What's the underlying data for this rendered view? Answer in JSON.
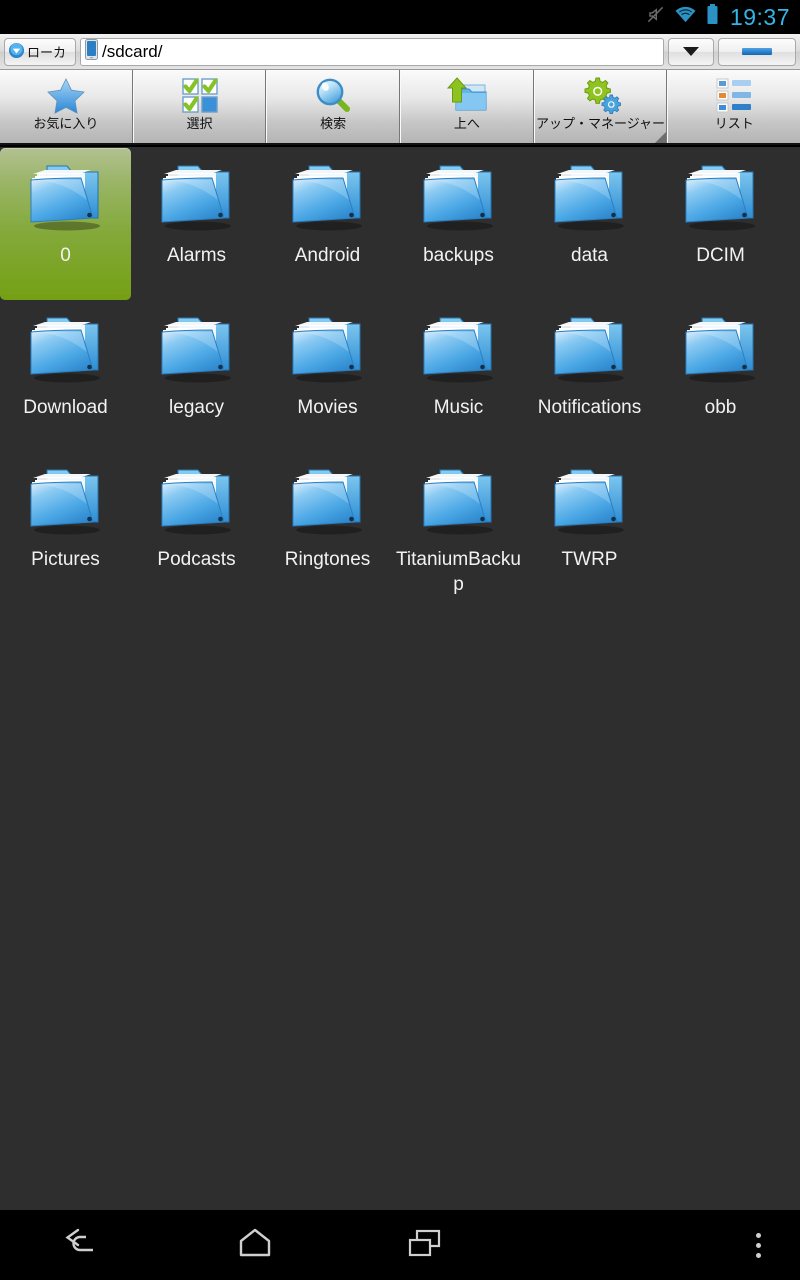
{
  "statusbar": {
    "time": "19:37",
    "icons": [
      "silent-mode-icon",
      "wifi-icon",
      "battery-icon"
    ]
  },
  "addressbar": {
    "location_button_label": "ローカ",
    "location_button_icon": "blue-dropdown-icon",
    "path_value": "/sdcard/",
    "path_placeholder": "/sdcard/",
    "path_icon": "device-storage-icon",
    "dropdown_icon": "chevron-down-icon",
    "minimize_icon": "minimize-icon"
  },
  "toolbar": {
    "buttons": [
      {
        "label": "お気に入り",
        "icon": "star-icon",
        "overflow": false
      },
      {
        "label": "選択",
        "icon": "checkbox-grid-icon",
        "overflow": false
      },
      {
        "label": "検索",
        "icon": "search-icon",
        "overflow": false
      },
      {
        "label": "上へ",
        "icon": "folder-up-icon",
        "overflow": false
      },
      {
        "label": "アップ・マネージャー",
        "icon": "gears-icon",
        "overflow": true
      },
      {
        "label": "リスト",
        "icon": "list-view-icon",
        "overflow": false
      }
    ]
  },
  "filegrid": {
    "items": [
      {
        "name": "0",
        "type": "folder",
        "selected": true
      },
      {
        "name": "Alarms",
        "type": "folder",
        "selected": false
      },
      {
        "name": "Android",
        "type": "folder",
        "selected": false
      },
      {
        "name": "backups",
        "type": "folder",
        "selected": false
      },
      {
        "name": "data",
        "type": "folder",
        "selected": false
      },
      {
        "name": "DCIM",
        "type": "folder",
        "selected": false
      },
      {
        "name": "Download",
        "type": "folder",
        "selected": false
      },
      {
        "name": "legacy",
        "type": "folder",
        "selected": false
      },
      {
        "name": "Movies",
        "type": "folder",
        "selected": false
      },
      {
        "name": "Music",
        "type": "folder",
        "selected": false
      },
      {
        "name": "Notifications",
        "type": "folder",
        "selected": false
      },
      {
        "name": "obb",
        "type": "folder",
        "selected": false
      },
      {
        "name": "Pictures",
        "type": "folder",
        "selected": false
      },
      {
        "name": "Podcasts",
        "type": "folder",
        "selected": false
      },
      {
        "name": "Ringtones",
        "type": "folder",
        "selected": false
      },
      {
        "name": "TitaniumBackup",
        "type": "folder",
        "selected": false
      },
      {
        "name": "TWRP",
        "type": "folder",
        "selected": false
      }
    ]
  },
  "navbar": {
    "buttons": [
      {
        "name": "back",
        "icon": "back-arrow-icon"
      },
      {
        "name": "home",
        "icon": "home-icon"
      },
      {
        "name": "recents",
        "icon": "recent-apps-icon"
      },
      {
        "name": "more",
        "icon": "overflow-menu-icon"
      }
    ]
  },
  "colors": {
    "accent_blue": "#33b5e5",
    "selection_green": "#84a93b",
    "grid_background": "#2e2e2e",
    "folder_blue": "#4a9fe0"
  }
}
